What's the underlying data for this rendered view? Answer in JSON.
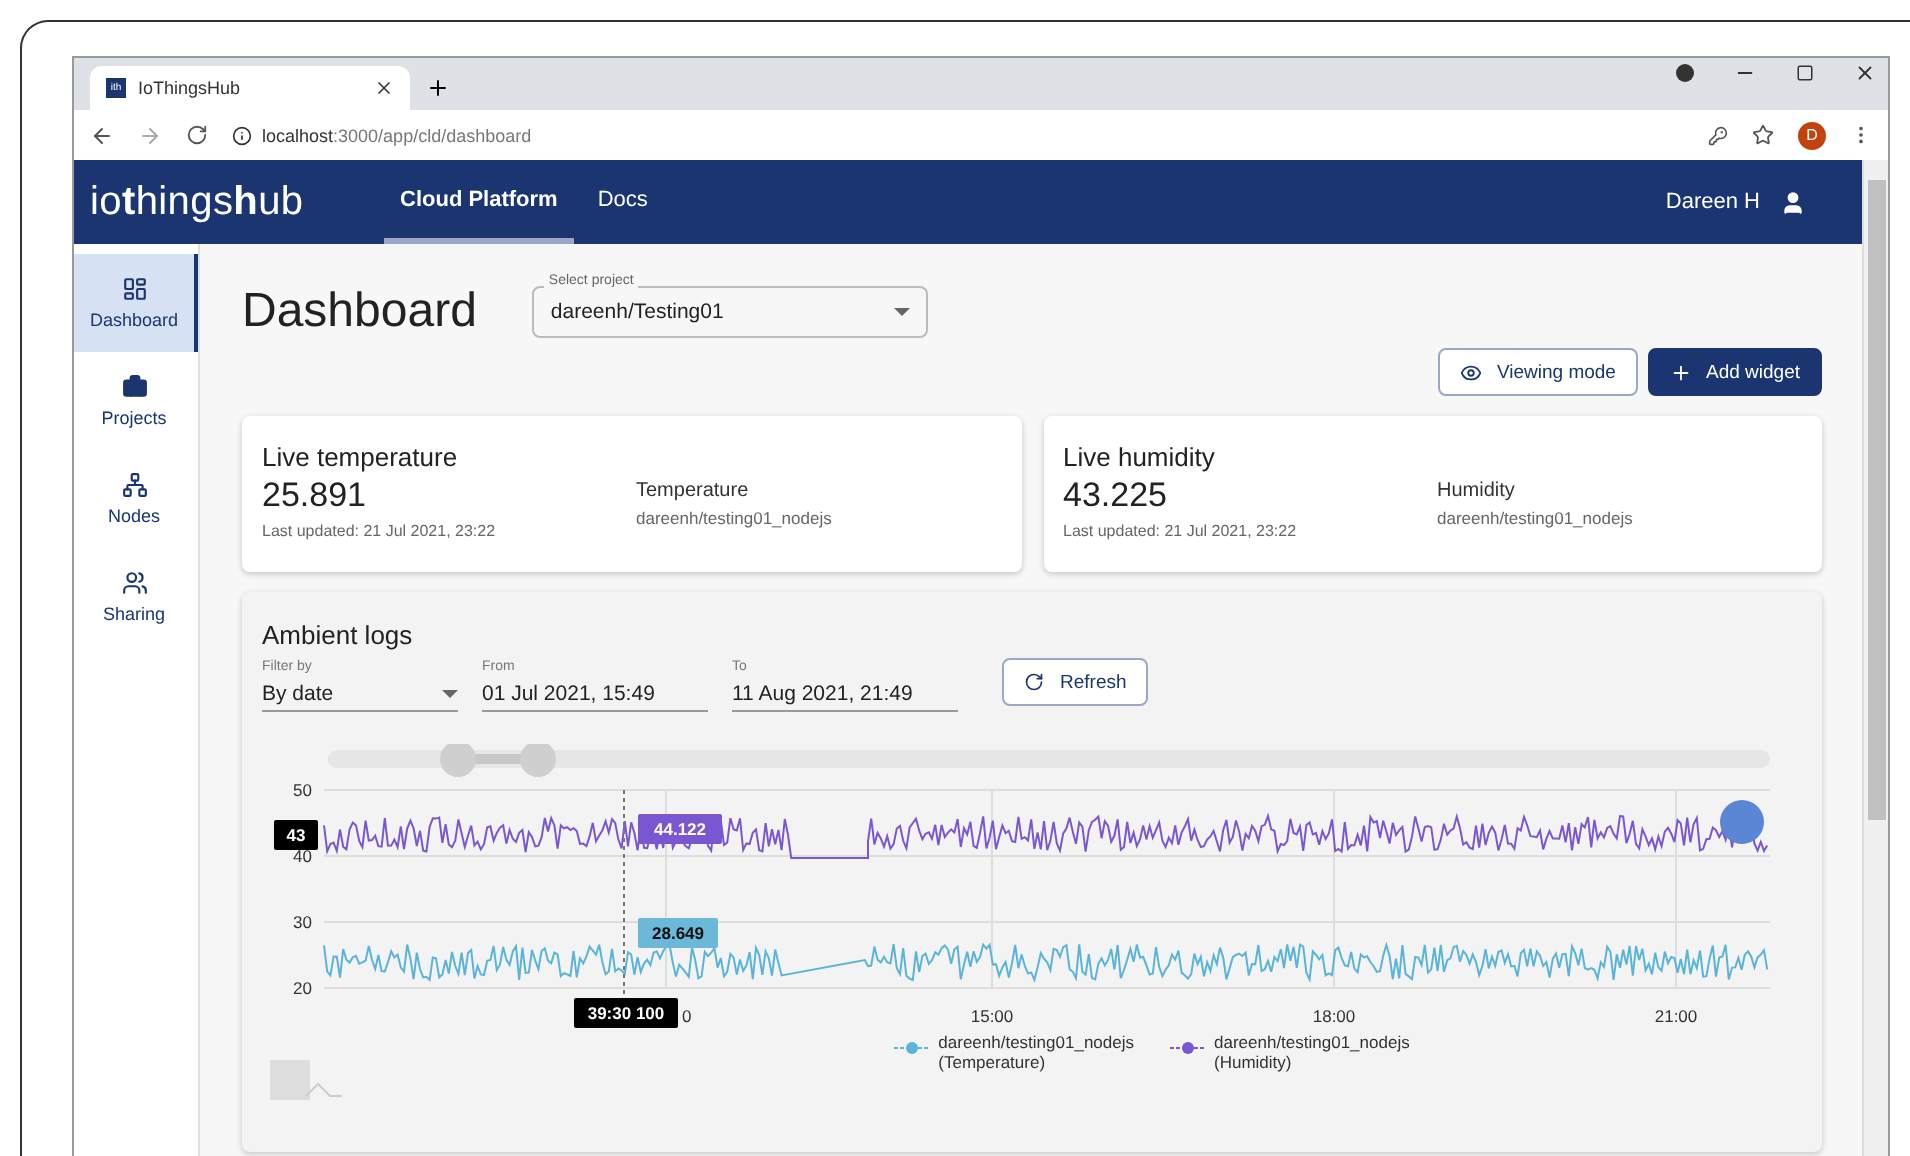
{
  "browser": {
    "tab_title": "IoThingsHub",
    "tab_icon": "ith",
    "url_host": "localhost",
    "url_path": ":3000/app/cld/dashboard",
    "profile": "D"
  },
  "app": {
    "logo": [
      {
        "text": "io",
        "bold": false
      },
      {
        "text": "t",
        "bold": true
      },
      {
        "text": "hings",
        "bold": false
      },
      {
        "text": "h",
        "bold": true
      },
      {
        "text": "ub",
        "bold": false
      }
    ],
    "nav": [
      {
        "label": "Cloud Platform",
        "selected": true
      },
      {
        "label": "Docs",
        "selected": false
      }
    ],
    "user": "Dareen H"
  },
  "sidebar": {
    "items": [
      {
        "label": "Dashboard",
        "selected": true
      },
      {
        "label": "Projects",
        "selected": false
      },
      {
        "label": "Nodes",
        "selected": false
      },
      {
        "label": "Sharing",
        "selected": false
      }
    ]
  },
  "page": {
    "title": "Dashboard",
    "project_select": {
      "label": "Select project",
      "value": "dareenh/Testing01"
    },
    "buttons": [
      {
        "label": "Viewing mode",
        "kind": "outline"
      },
      {
        "label": "Add widget",
        "kind": "primary"
      }
    ]
  },
  "widgets": [
    {
      "title": "Live temperature",
      "value": "25.891",
      "updated": "Last updated: 21 Jul 2021, 23:22",
      "sensor": "Temperature",
      "node": "dareenh/testing01_nodejs"
    },
    {
      "title": "Live humidity",
      "value": "43.225",
      "updated": "Last updated: 21 Jul 2021, 23:22",
      "sensor": "Humidity",
      "node": "dareenh/testing01_nodejs"
    }
  ],
  "logs": {
    "title": "Ambient logs",
    "filters": [
      {
        "label": "Filter by",
        "value": "By date",
        "kind": "select"
      },
      {
        "label": "From",
        "value": "01 Jul 2021, 15:49",
        "kind": "text"
      },
      {
        "label": "To",
        "value": "11 Aug 2021, 21:49",
        "kind": "text"
      }
    ],
    "refresh": "Refresh",
    "chart": {
      "yticks": [
        "50",
        "40",
        "30",
        "20"
      ],
      "xticks": [
        "0",
        "15:00",
        "18:00",
        "21:00"
      ],
      "tooltips": [
        {
          "text": "43",
          "kind": "axis"
        },
        {
          "text": "44.122",
          "kind": "humidity"
        },
        {
          "text": "28.649",
          "kind": "temperature"
        },
        {
          "text": "39:30 100",
          "kind": "time"
        }
      ],
      "legend": [
        {
          "name": "dareenh/testing01_nodejs",
          "sub": "(Temperature)",
          "color": "#5ab4d9"
        },
        {
          "name": "dareenh/testing01_nodejs",
          "sub": "(Humidity)",
          "color": "#7a57d1"
        }
      ]
    }
  }
}
